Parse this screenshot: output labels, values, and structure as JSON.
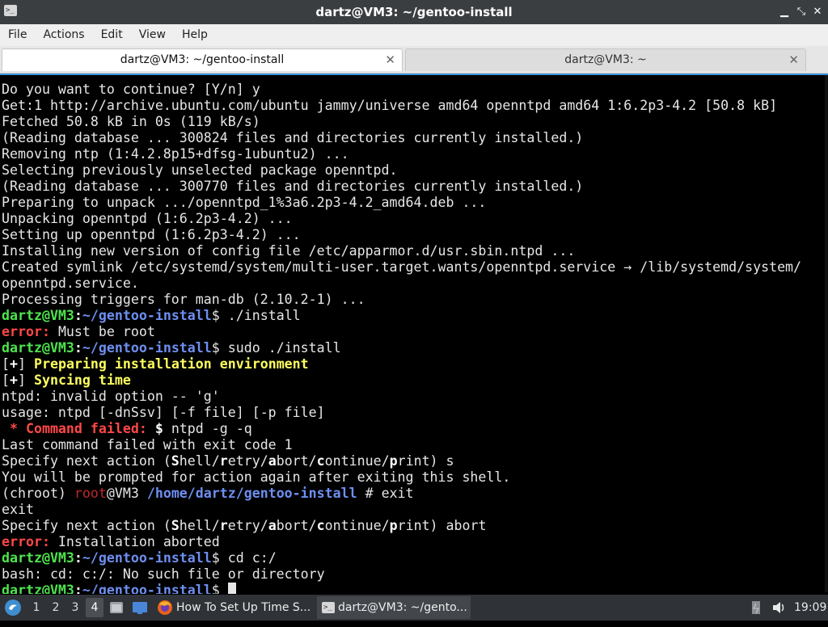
{
  "window": {
    "title": "dartz@VM3: ~/gentoo-install",
    "app_icon": "terminal-icon",
    "controls": [
      "minimize-icon",
      "maximize-icon",
      "close-icon"
    ]
  },
  "menu": [
    "File",
    "Actions",
    "Edit",
    "View",
    "Help"
  ],
  "tabs": [
    {
      "label": "dartz@VM3: ~/gentoo-install",
      "active": true
    },
    {
      "label": "dartz@VM3: ~",
      "active": false
    }
  ],
  "colors": {
    "prompt_user": "#4ee44e",
    "prompt_path": "#6e8ff0",
    "error": "#ff4848",
    "highlight": "#ffff60",
    "root_user": "#c0282a",
    "terminal_bg": "#000000",
    "focus_border": "#3a8fd9"
  },
  "terminal": {
    "lines": [
      [
        {
          "t": "Do you want to continue? [Y/n] y"
        }
      ],
      [
        {
          "t": "Get:1 http://archive.ubuntu.com/ubuntu jammy/universe amd64 openntpd amd64 1:6.2p3-4.2 [50.8 kB]"
        }
      ],
      [
        {
          "t": "Fetched 50.8 kB in 0s (119 kB/s)"
        }
      ],
      [
        {
          "t": "(Reading database ... 300824 files and directories currently installed.)"
        }
      ],
      [
        {
          "t": "Removing ntp (1:4.2.8p15+dfsg-1ubuntu2) ..."
        }
      ],
      [
        {
          "t": "Selecting previously unselected package openntpd."
        }
      ],
      [
        {
          "t": "(Reading database ... 300770 files and directories currently installed.)"
        }
      ],
      [
        {
          "t": "Preparing to unpack .../openntpd_1%3a6.2p3-4.2_amd64.deb ..."
        }
      ],
      [
        {
          "t": "Unpacking openntpd (1:6.2p3-4.2) ..."
        }
      ],
      [
        {
          "t": "Setting up openntpd (1:6.2p3-4.2) ..."
        }
      ],
      [
        {
          "t": "Installing new version of config file /etc/apparmor.d/usr.sbin.ntpd ..."
        }
      ],
      [
        {
          "t": "Created symlink /etc/systemd/system/multi-user.target.wants/openntpd.service → /lib/systemd/system/"
        }
      ],
      [
        {
          "t": "openntpd.service."
        }
      ],
      [
        {
          "t": "Processing triggers for man-db (2.10.2-1) ..."
        }
      ],
      [
        {
          "t": "dartz@VM3",
          "c": "g"
        },
        {
          "t": ":",
          "c": "bw"
        },
        {
          "t": "~/gentoo-install",
          "c": "b"
        },
        {
          "t": "$ ./install"
        }
      ],
      [
        {
          "t": "error:",
          "c": "r"
        },
        {
          "t": " Must be root"
        }
      ],
      [
        {
          "t": "dartz@VM3",
          "c": "g"
        },
        {
          "t": ":",
          "c": "bw"
        },
        {
          "t": "~/gentoo-install",
          "c": "b"
        },
        {
          "t": "$ sudo ./install"
        }
      ],
      [
        {
          "t": "[",
          "c": ""
        },
        {
          "t": "+",
          "c": "bw"
        },
        {
          "t": "] "
        },
        {
          "t": "Preparing installation environment",
          "c": "y"
        }
      ],
      [
        {
          "t": "[",
          "c": ""
        },
        {
          "t": "+",
          "c": "bw"
        },
        {
          "t": "] "
        },
        {
          "t": "Syncing time",
          "c": "y"
        }
      ],
      [
        {
          "t": "ntpd: invalid option -- 'g'"
        }
      ],
      [
        {
          "t": "usage: ntpd [-dnSsv] [-f file] [-p file]"
        }
      ],
      [
        {
          "t": " * Command failed: ",
          "c": "r"
        },
        {
          "t": "$",
          "c": "bw"
        },
        {
          "t": " ntpd -g -q"
        }
      ],
      [
        {
          "t": "Last command failed with exit code 1"
        }
      ],
      [
        {
          "t": "Specify next action ("
        },
        {
          "t": "S",
          "c": "bw"
        },
        {
          "t": "hell/"
        },
        {
          "t": "r",
          "c": "bw"
        },
        {
          "t": "etry/"
        },
        {
          "t": "a",
          "c": "bw"
        },
        {
          "t": "bort/"
        },
        {
          "t": "c",
          "c": "bw"
        },
        {
          "t": "ontinue/"
        },
        {
          "t": "p",
          "c": "bw"
        },
        {
          "t": "rint) s"
        }
      ],
      [
        {
          "t": "You will be prompted for action again after exiting this shell."
        }
      ],
      [
        {
          "t": "(chroot) "
        },
        {
          "t": "root",
          "c": "dr"
        },
        {
          "t": "@VM3 "
        },
        {
          "t": "/home/dartz/gentoo-install",
          "c": "b"
        },
        {
          "t": " # exit"
        }
      ],
      [
        {
          "t": "exit"
        }
      ],
      [
        {
          "t": "Specify next action ("
        },
        {
          "t": "S",
          "c": "bw"
        },
        {
          "t": "hell/"
        },
        {
          "t": "r",
          "c": "bw"
        },
        {
          "t": "etry/"
        },
        {
          "t": "a",
          "c": "bw"
        },
        {
          "t": "bort/"
        },
        {
          "t": "c",
          "c": "bw"
        },
        {
          "t": "ontinue/"
        },
        {
          "t": "p",
          "c": "bw"
        },
        {
          "t": "rint) abort"
        }
      ],
      [
        {
          "t": "error:",
          "c": "r"
        },
        {
          "t": " Installation aborted"
        }
      ],
      [
        {
          "t": "dartz@VM3",
          "c": "g"
        },
        {
          "t": ":",
          "c": "bw"
        },
        {
          "t": "~/gentoo-install",
          "c": "b"
        },
        {
          "t": "$ cd c:/"
        }
      ],
      [
        {
          "t": "bash: cd: c:/: No such file or directory"
        }
      ],
      [
        {
          "t": "dartz@VM3",
          "c": "g"
        },
        {
          "t": ":",
          "c": "bw"
        },
        {
          "t": "~/gentoo-install",
          "c": "b"
        },
        {
          "t": "$ "
        }
      ]
    ]
  },
  "taskbar": {
    "menu_icon": "distro-menu-icon",
    "workspaces": [
      "1",
      "2",
      "3",
      "4"
    ],
    "active_workspace": "4",
    "launchers": [
      "file-manager-icon",
      "desktop-icon"
    ],
    "tasks": [
      {
        "label": "How To Set Up Time S...",
        "icon": "firefox-icon",
        "active": false
      },
      {
        "label": "dartz@VM3: ~/gento...",
        "icon": "terminal-icon",
        "active": true
      }
    ],
    "tray_icons": [
      "battery-icon",
      "volume-icon"
    ],
    "clock": "19:09"
  }
}
